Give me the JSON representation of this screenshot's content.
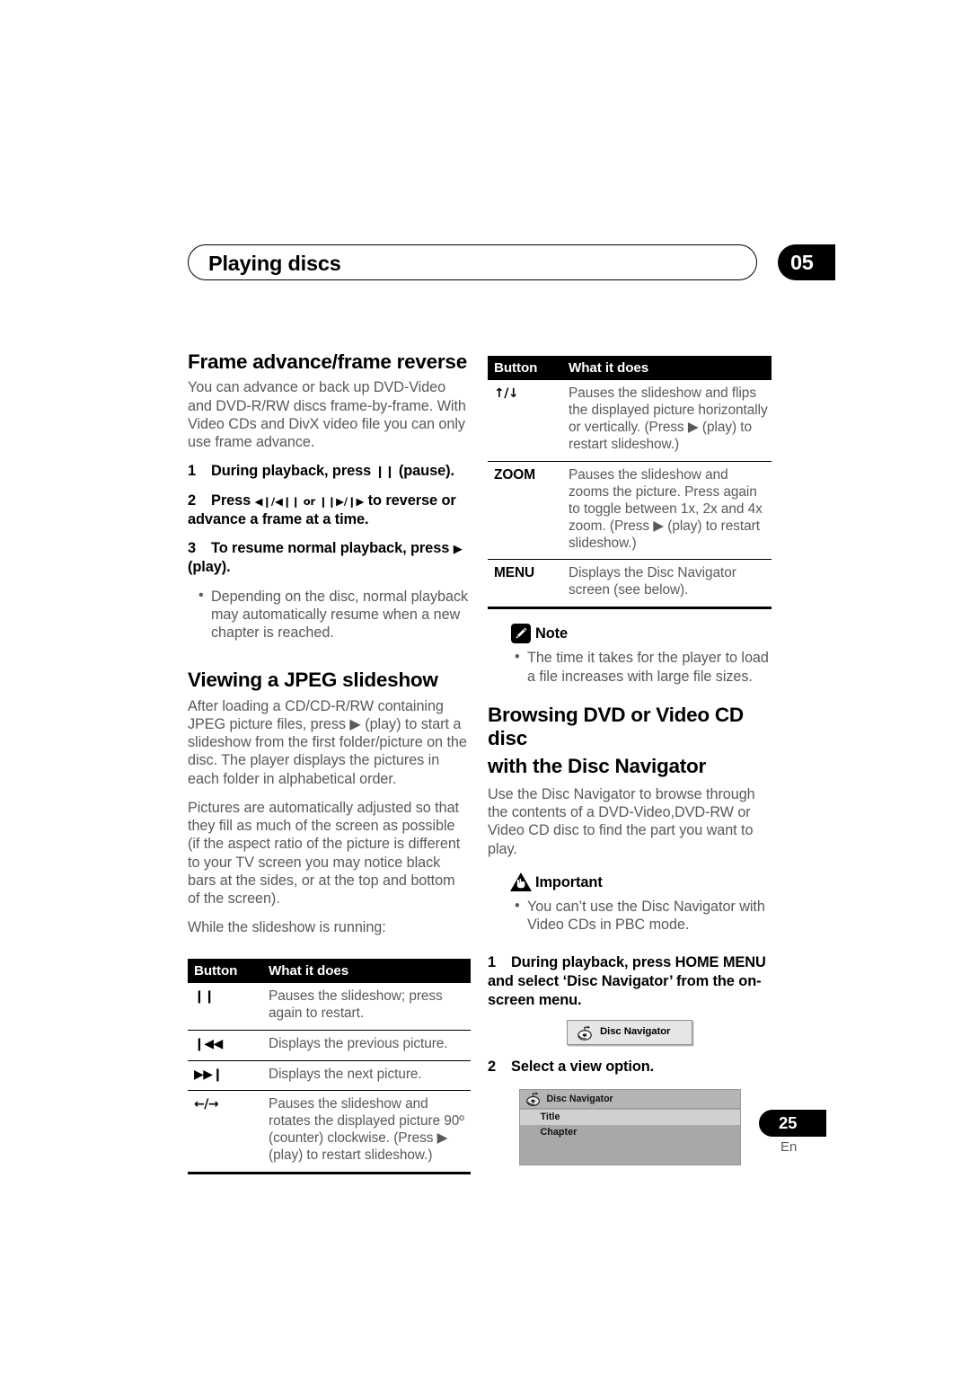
{
  "header": {
    "title": "Playing discs",
    "chapter": "05"
  },
  "left_column": {
    "section1": {
      "heading": "Frame advance/frame reverse",
      "intro": "You can advance or back up DVD-Video and DVD-R/RW discs frame-by-frame. With Video CDs and DivX video file you can only use frame advance.",
      "steps": [
        {
          "num": "1",
          "text_before": "During playback, press ",
          "glyph": "❙❙",
          "text_after": " (pause)."
        },
        {
          "num": "2",
          "text_before": "Press ",
          "glyph": "◀❙/◀❙❙ or ❙❙▶/❙▶",
          "text_after": " to reverse or advance a frame at a time."
        },
        {
          "num": "3",
          "text_before": "To resume normal playback, press ",
          "glyph": "▶",
          "text_after": " (play)."
        }
      ],
      "bullets": [
        "Depending on the disc, normal playback may automatically resume when a new chapter is reached."
      ]
    },
    "section2": {
      "heading": "Viewing a JPEG slideshow",
      "paragraphs": [
        "After loading a CD/CD-R/RW containing JPEG picture files, press ▶ (play) to start a slideshow from the first folder/picture on the disc. The player displays the pictures in each folder in alphabetical order.",
        "Pictures are automatically adjusted so that they fill as much of the screen as possible (if the aspect ratio of the picture is different to your TV screen you may notice black bars at the sides, or at the top and bottom of the screen).",
        "While the slideshow is running:"
      ]
    },
    "table": {
      "headers": [
        "Button",
        "What it does"
      ],
      "rows": [
        {
          "key": "❙❙",
          "desc": "Pauses the slideshow; press again to restart."
        },
        {
          "key": "❙◀◀",
          "desc": "Displays the previous picture."
        },
        {
          "key": "▶▶❙",
          "desc": "Displays the next picture."
        },
        {
          "key": "←/→",
          "desc": "Pauses the slideshow and rotates the displayed picture 90º (counter) clockwise. (Press ▶ (play) to restart slideshow.)"
        }
      ]
    }
  },
  "right_column": {
    "table": {
      "headers": [
        "Button",
        "What it does"
      ],
      "rows": [
        {
          "key": "↑/↓",
          "desc": "Pauses the slideshow and flips the displayed picture horizontally or vertically. (Press ▶ (play) to restart slideshow.)"
        },
        {
          "key": "ZOOM",
          "desc": "Pauses the slideshow and zooms the picture. Press again to toggle between 1x, 2x and 4x zoom. (Press ▶ (play) to restart slideshow.)"
        },
        {
          "key": "MENU",
          "desc": "Displays the Disc Navigator screen (see below)."
        }
      ]
    },
    "note": {
      "label": "Note",
      "bullets": [
        "The time it takes for the player to load a file increases with large file sizes."
      ]
    },
    "section": {
      "heading_line1": "Browsing DVD or Video CD disc",
      "heading_line2": "with the Disc Navigator",
      "intro": "Use the Disc Navigator to browse through the contents of a DVD-Video,DVD-RW or Video CD disc to find the part you want to play."
    },
    "important": {
      "label": "Important",
      "bullets": [
        "You can’t use the Disc Navigator with Video CDs in PBC mode."
      ]
    },
    "steps": [
      {
        "num": "1",
        "text": "During playback, press HOME MENU and select ‘Disc Navigator’ from the on-screen menu."
      },
      {
        "num": "2",
        "text": "Select a view option."
      }
    ],
    "osd_button": {
      "label": "Disc Navigator"
    },
    "osd_navigator": {
      "title": "Disc Navigator",
      "items": [
        "Title",
        "Chapter"
      ]
    }
  },
  "footer": {
    "page_number": "25",
    "language": "En"
  }
}
